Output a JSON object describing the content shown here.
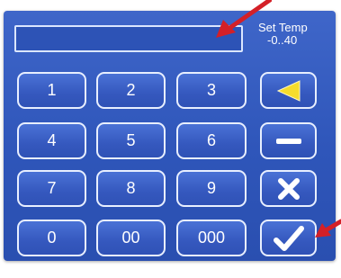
{
  "display": {
    "value": ""
  },
  "set_temp": {
    "label": "Set Temp",
    "range": "-0..40"
  },
  "keys": {
    "k1": "1",
    "k2": "2",
    "k3": "3",
    "k4": "4",
    "k5": "5",
    "k6": "6",
    "k7": "7",
    "k8": "8",
    "k9": "9",
    "k0": "0",
    "k00": "00",
    "k000": "000"
  },
  "function_keys": {
    "backspace": "left-arrow-icon",
    "minus": "minus-icon",
    "clear": "x-icon",
    "enter": "checkmark-icon"
  },
  "colors": {
    "panel": "#2f56ba",
    "key_border": "#e8efff",
    "arrow_red": "#d42027",
    "accent_yellow": "#f6dc2c"
  }
}
